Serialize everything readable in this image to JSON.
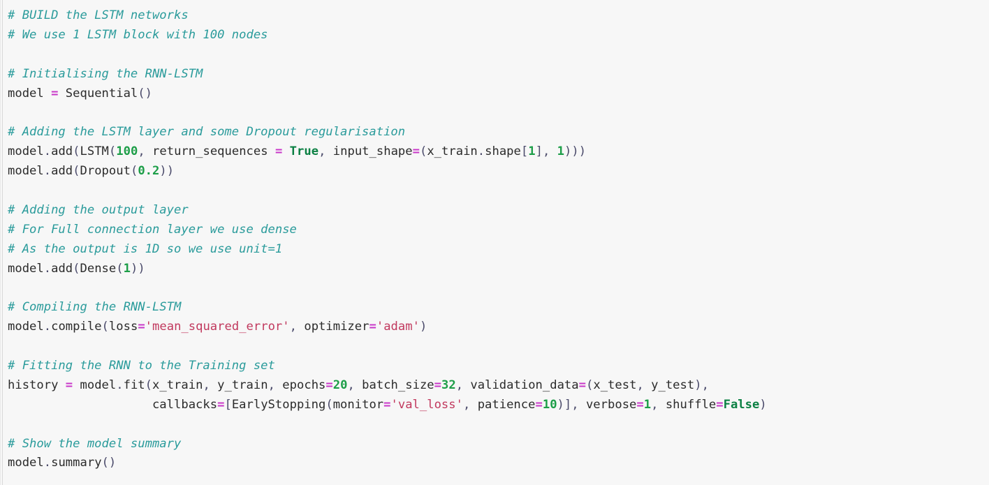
{
  "cell": {
    "language": "python",
    "background_color": "#f7f7f7",
    "gutter_color": "#d8d8d8"
  },
  "colors": {
    "comment": "#2a9b9b",
    "operator": "#c837c8",
    "number": "#1d9e48",
    "string": "#c1395e",
    "keyword": "#0b8043",
    "identifier": "#2b2b2b",
    "punctuation": "#4a4a6a"
  },
  "code": {
    "lines": [
      {
        "id": "l1",
        "tokens": [
          {
            "t": "comment",
            "v": "# BUILD the LSTM networks"
          }
        ]
      },
      {
        "id": "l2",
        "tokens": [
          {
            "t": "comment",
            "v": "# We use 1 LSTM block with 100 nodes"
          }
        ]
      },
      {
        "id": "l3",
        "tokens": []
      },
      {
        "id": "l4",
        "tokens": [
          {
            "t": "comment",
            "v": "# Initialising the RNN-LSTM"
          }
        ]
      },
      {
        "id": "l5",
        "tokens": [
          {
            "t": "name",
            "v": "model "
          },
          {
            "t": "op",
            "v": "="
          },
          {
            "t": "name",
            "v": " Sequential"
          },
          {
            "t": "punc",
            "v": "()"
          }
        ]
      },
      {
        "id": "l6",
        "tokens": []
      },
      {
        "id": "l7",
        "tokens": [
          {
            "t": "comment",
            "v": "# Adding the LSTM layer and some Dropout regularisation"
          }
        ]
      },
      {
        "id": "l8",
        "tokens": [
          {
            "t": "name",
            "v": "model"
          },
          {
            "t": "punc",
            "v": "."
          },
          {
            "t": "name",
            "v": "add"
          },
          {
            "t": "punc",
            "v": "("
          },
          {
            "t": "name",
            "v": "LSTM"
          },
          {
            "t": "punc",
            "v": "("
          },
          {
            "t": "num",
            "v": "100"
          },
          {
            "t": "punc",
            "v": ", "
          },
          {
            "t": "name",
            "v": "return_sequences "
          },
          {
            "t": "op",
            "v": "="
          },
          {
            "t": "name",
            "v": " "
          },
          {
            "t": "kw",
            "v": "True"
          },
          {
            "t": "punc",
            "v": ", "
          },
          {
            "t": "name",
            "v": "input_shape"
          },
          {
            "t": "op",
            "v": "="
          },
          {
            "t": "punc",
            "v": "("
          },
          {
            "t": "name",
            "v": "x_train"
          },
          {
            "t": "punc",
            "v": "."
          },
          {
            "t": "name",
            "v": "shape"
          },
          {
            "t": "punc",
            "v": "["
          },
          {
            "t": "num",
            "v": "1"
          },
          {
            "t": "punc",
            "v": "], "
          },
          {
            "t": "num",
            "v": "1"
          },
          {
            "t": "punc",
            "v": ")))"
          }
        ]
      },
      {
        "id": "l9",
        "tokens": [
          {
            "t": "name",
            "v": "model"
          },
          {
            "t": "punc",
            "v": "."
          },
          {
            "t": "name",
            "v": "add"
          },
          {
            "t": "punc",
            "v": "("
          },
          {
            "t": "name",
            "v": "Dropout"
          },
          {
            "t": "punc",
            "v": "("
          },
          {
            "t": "num",
            "v": "0.2"
          },
          {
            "t": "punc",
            "v": "))"
          }
        ]
      },
      {
        "id": "l10",
        "tokens": []
      },
      {
        "id": "l11",
        "tokens": [
          {
            "t": "comment",
            "v": "# Adding the output layer"
          }
        ]
      },
      {
        "id": "l12",
        "tokens": [
          {
            "t": "comment",
            "v": "# For Full connection layer we use dense"
          }
        ]
      },
      {
        "id": "l13",
        "tokens": [
          {
            "t": "comment",
            "v": "# As the output is 1D so we use unit=1"
          }
        ]
      },
      {
        "id": "l14",
        "tokens": [
          {
            "t": "name",
            "v": "model"
          },
          {
            "t": "punc",
            "v": "."
          },
          {
            "t": "name",
            "v": "add"
          },
          {
            "t": "punc",
            "v": "("
          },
          {
            "t": "name",
            "v": "Dense"
          },
          {
            "t": "punc",
            "v": "("
          },
          {
            "t": "num",
            "v": "1"
          },
          {
            "t": "punc",
            "v": "))"
          }
        ]
      },
      {
        "id": "l15",
        "tokens": []
      },
      {
        "id": "l16",
        "tokens": [
          {
            "t": "comment",
            "v": "# Compiling the RNN-LSTM"
          }
        ]
      },
      {
        "id": "l17",
        "tokens": [
          {
            "t": "name",
            "v": "model"
          },
          {
            "t": "punc",
            "v": "."
          },
          {
            "t": "name",
            "v": "compile"
          },
          {
            "t": "punc",
            "v": "("
          },
          {
            "t": "name",
            "v": "loss"
          },
          {
            "t": "op",
            "v": "="
          },
          {
            "t": "str",
            "v": "'mean_squared_error'"
          },
          {
            "t": "punc",
            "v": ", "
          },
          {
            "t": "name",
            "v": "optimizer"
          },
          {
            "t": "op",
            "v": "="
          },
          {
            "t": "str",
            "v": "'adam'"
          },
          {
            "t": "punc",
            "v": ")"
          }
        ]
      },
      {
        "id": "l18",
        "tokens": []
      },
      {
        "id": "l19",
        "tokens": [
          {
            "t": "comment",
            "v": "# Fitting the RNN to the Training set"
          }
        ]
      },
      {
        "id": "l20",
        "tokens": [
          {
            "t": "name",
            "v": "history "
          },
          {
            "t": "op",
            "v": "="
          },
          {
            "t": "name",
            "v": " model"
          },
          {
            "t": "punc",
            "v": "."
          },
          {
            "t": "name",
            "v": "fit"
          },
          {
            "t": "punc",
            "v": "("
          },
          {
            "t": "name",
            "v": "x_train"
          },
          {
            "t": "punc",
            "v": ", "
          },
          {
            "t": "name",
            "v": "y_train"
          },
          {
            "t": "punc",
            "v": ", "
          },
          {
            "t": "name",
            "v": "epochs"
          },
          {
            "t": "op",
            "v": "="
          },
          {
            "t": "num",
            "v": "20"
          },
          {
            "t": "punc",
            "v": ", "
          },
          {
            "t": "name",
            "v": "batch_size"
          },
          {
            "t": "op",
            "v": "="
          },
          {
            "t": "num",
            "v": "32"
          },
          {
            "t": "punc",
            "v": ", "
          },
          {
            "t": "name",
            "v": "validation_data"
          },
          {
            "t": "op",
            "v": "="
          },
          {
            "t": "punc",
            "v": "("
          },
          {
            "t": "name",
            "v": "x_test"
          },
          {
            "t": "punc",
            "v": ", "
          },
          {
            "t": "name",
            "v": "y_test"
          },
          {
            "t": "punc",
            "v": "),"
          }
        ]
      },
      {
        "id": "l21",
        "tokens": [
          {
            "t": "name",
            "v": "                    callbacks"
          },
          {
            "t": "op",
            "v": "="
          },
          {
            "t": "punc",
            "v": "["
          },
          {
            "t": "name",
            "v": "EarlyStopping"
          },
          {
            "t": "punc",
            "v": "("
          },
          {
            "t": "name",
            "v": "monitor"
          },
          {
            "t": "op",
            "v": "="
          },
          {
            "t": "str",
            "v": "'val_loss'"
          },
          {
            "t": "punc",
            "v": ", "
          },
          {
            "t": "name",
            "v": "patience"
          },
          {
            "t": "op",
            "v": "="
          },
          {
            "t": "num",
            "v": "10"
          },
          {
            "t": "punc",
            "v": ")], "
          },
          {
            "t": "name",
            "v": "verbose"
          },
          {
            "t": "op",
            "v": "="
          },
          {
            "t": "num",
            "v": "1"
          },
          {
            "t": "punc",
            "v": ", "
          },
          {
            "t": "name",
            "v": "shuffle"
          },
          {
            "t": "op",
            "v": "="
          },
          {
            "t": "kw",
            "v": "False"
          },
          {
            "t": "punc",
            "v": ")"
          }
        ]
      },
      {
        "id": "l22",
        "tokens": []
      },
      {
        "id": "l23",
        "tokens": [
          {
            "t": "comment",
            "v": "# Show the model summary"
          }
        ]
      },
      {
        "id": "l24",
        "tokens": [
          {
            "t": "name",
            "v": "model"
          },
          {
            "t": "punc",
            "v": "."
          },
          {
            "t": "name",
            "v": "summary"
          },
          {
            "t": "punc",
            "v": "()"
          }
        ]
      }
    ]
  }
}
